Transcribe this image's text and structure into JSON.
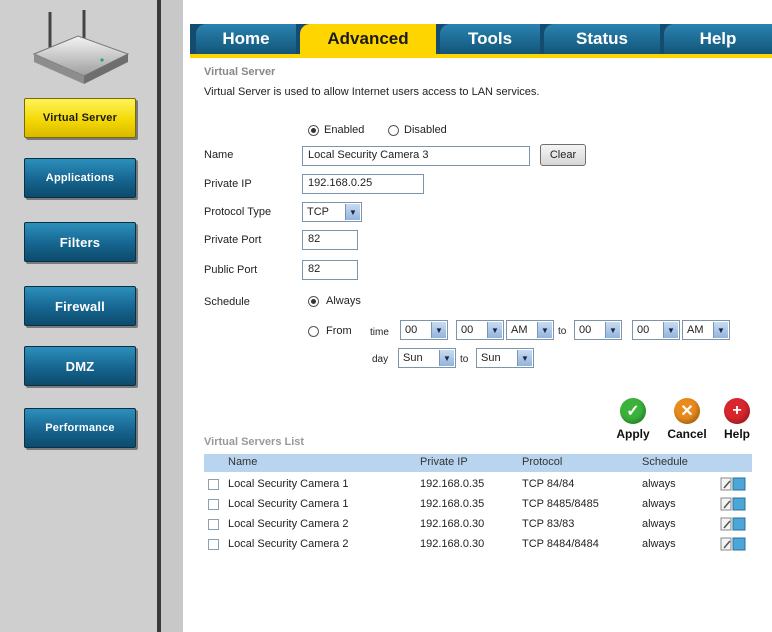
{
  "sidebar": {
    "items": [
      {
        "label": "Virtual Server",
        "active": true
      },
      {
        "label": "Applications",
        "active": false
      },
      {
        "label": "Filters",
        "active": false
      },
      {
        "label": "Firewall",
        "active": false
      },
      {
        "label": "DMZ",
        "active": false
      },
      {
        "label": "Performance",
        "active": false
      }
    ]
  },
  "tabs": [
    {
      "label": "Home",
      "active": false
    },
    {
      "label": "Advanced",
      "active": true
    },
    {
      "label": "Tools",
      "active": false
    },
    {
      "label": "Status",
      "active": false
    },
    {
      "label": "Help",
      "active": false
    }
  ],
  "section": {
    "title": "Virtual Server",
    "description": "Virtual Server is used to allow Internet users access to LAN services."
  },
  "form": {
    "enabled_label": "Enabled",
    "disabled_label": "Disabled",
    "enabled": true,
    "name_label": "Name",
    "name_value": "Local Security Camera 3",
    "clear_label": "Clear",
    "private_ip_label": "Private IP",
    "private_ip_value": "192.168.0.25",
    "protocol_label": "Protocol Type",
    "protocol_value": "TCP",
    "private_port_label": "Private Port",
    "private_port_value": "82",
    "public_port_label": "Public Port",
    "public_port_value": "82",
    "schedule_label": "Schedule",
    "always_label": "Always",
    "from_label": "From",
    "time_label": "time",
    "to_label": "to",
    "day_label": "day",
    "from_hour": "00",
    "from_min": "00",
    "from_ampm": "AM",
    "to_hour": "00",
    "to_min": "00",
    "to_ampm": "AM",
    "day_from": "Sun",
    "day_to": "Sun"
  },
  "actions": {
    "apply": "Apply",
    "cancel": "Cancel",
    "help": "Help"
  },
  "list": {
    "title": "Virtual Servers List",
    "headers": [
      "Name",
      "Private IP",
      "Protocol",
      "Schedule"
    ],
    "rows": [
      {
        "name": "Local Security Camera 1",
        "ip": "192.168.0.35",
        "protocol": "TCP 84/84",
        "schedule": "always"
      },
      {
        "name": "Local Security Camera 1",
        "ip": "192.168.0.35",
        "protocol": "TCP 8485/8485",
        "schedule": "always"
      },
      {
        "name": "Local Security Camera 2",
        "ip": "192.168.0.30",
        "protocol": "TCP 83/83",
        "schedule": "always"
      },
      {
        "name": "Local Security Camera 2",
        "ip": "192.168.0.30",
        "protocol": "TCP 8484/8484",
        "schedule": "always"
      }
    ]
  },
  "colors": {
    "accent_yellow": "#ffd500",
    "tab_blue": "#125579",
    "header_blue": "#b9d4ee"
  }
}
